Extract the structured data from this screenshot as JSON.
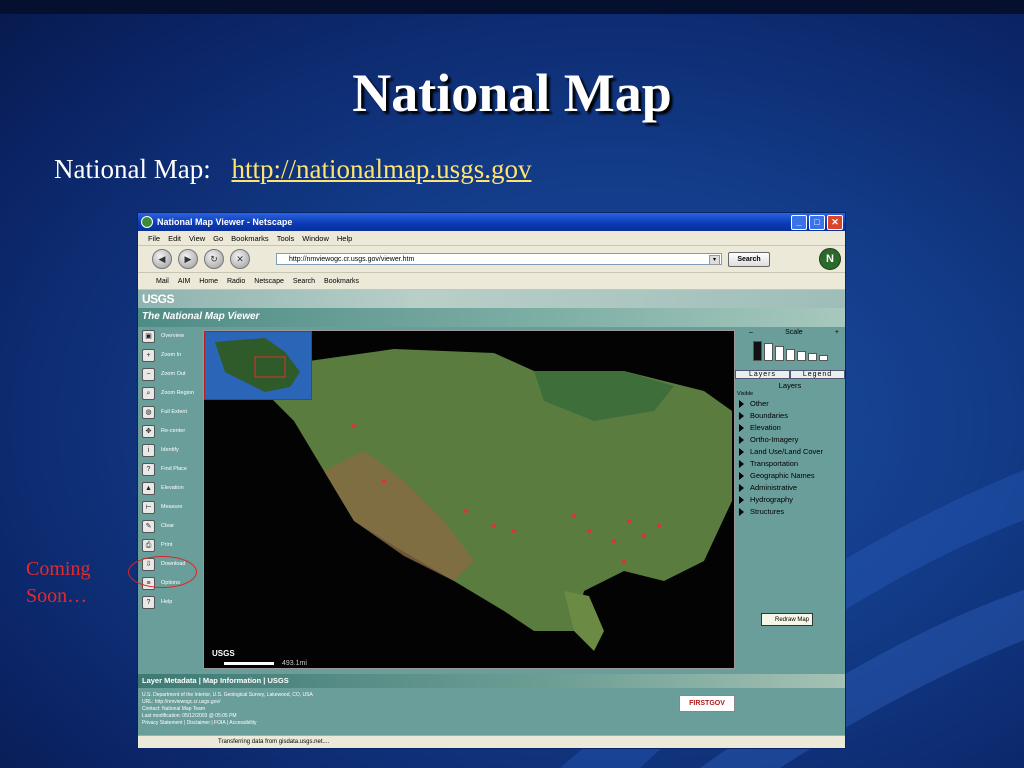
{
  "slide": {
    "title": "National Map",
    "subtitle_label": "National Map:",
    "subtitle_link": "http://nationalmap.usgs.gov",
    "callout_line1": "Coming",
    "callout_line2": "Soon…"
  },
  "browser": {
    "window_title": "National Map Viewer - Netscape",
    "menu": [
      "File",
      "Edit",
      "View",
      "Go",
      "Bookmarks",
      "Tools",
      "Window",
      "Help"
    ],
    "url": "http://nmviewogc.cr.usgs.gov/viewer.htm",
    "search_label": "Search",
    "personal_toolbar": [
      "Mail",
      "AIM",
      "Home",
      "Radio",
      "Netscape",
      "Search",
      "Bookmarks"
    ],
    "status_text": "Transferring data from gisdata.usgs.net...."
  },
  "page": {
    "logo_text": "USGS",
    "viewer_title": "The National Map Viewer",
    "tools": [
      "Overview",
      "Zoom In",
      "Zoom Out",
      "Zoom Region",
      "Full Extent",
      "Re-center",
      "Identify",
      "Find Place",
      "Elevation",
      "Measure",
      "Clear",
      "Print",
      "Download",
      "Options",
      "Help"
    ],
    "scale": {
      "label": "Scale",
      "minus": "–",
      "plus": "+"
    },
    "tabs": [
      "Layers",
      "Legend"
    ],
    "layers_header": "Layers",
    "visible_label": "Visible",
    "layers": [
      "Other",
      "Boundaries",
      "Elevation",
      "Ortho-Imagery",
      "Land Use/Land Cover",
      "Transportation",
      "Geographic Names",
      "Administrative",
      "Hydrography",
      "Structures"
    ],
    "redraw_label": "Redraw Map",
    "map_logo": "USGS",
    "map_scale": "493.1mi",
    "metadata_bar": "Layer Metadata | Map Information | USGS",
    "footer_lines": [
      "U.S. Department of the Interior, U.S. Geological Survey, Lakewood, CO, USA",
      "URL: http://nmviewogc.cr.usgs.gov/",
      "Contact: National Map Team",
      "Last modification: 05/12/2003 @ 05:05 PM",
      "Privacy Statement | Disclaimer | FOIA | Accessibility"
    ],
    "firstgov": "FIRSTGOV"
  }
}
